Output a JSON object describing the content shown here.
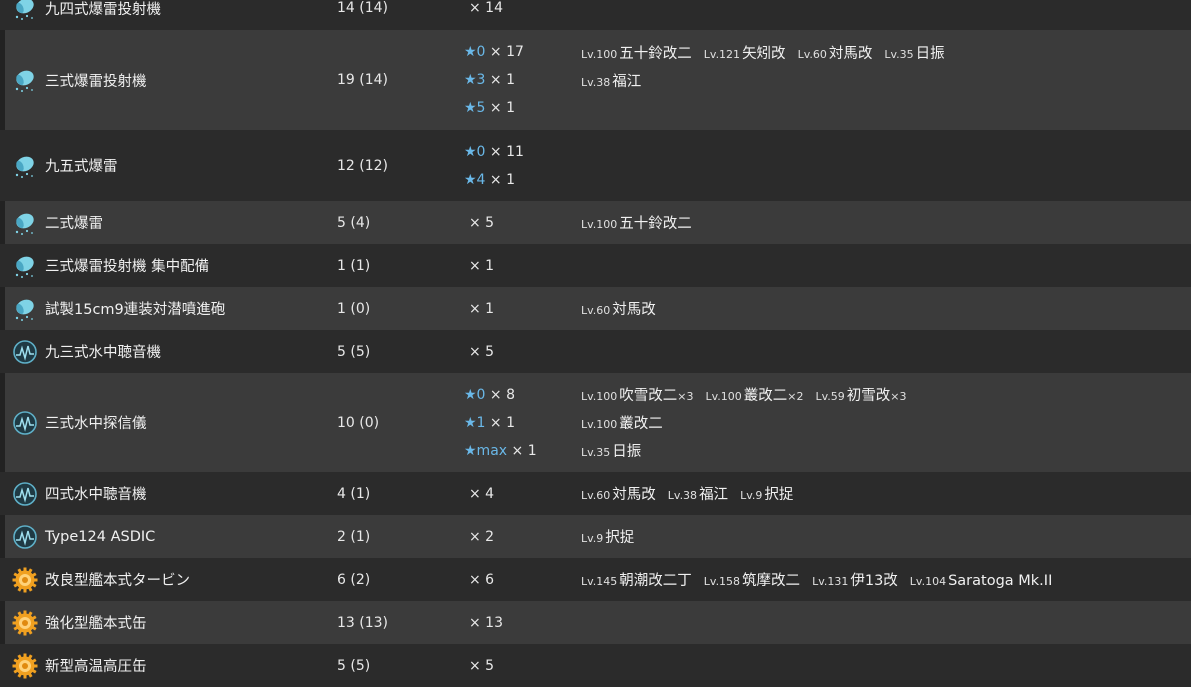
{
  "colors": {
    "row_odd": "#2b2b2b",
    "row_even": "#3b3b3b",
    "star": "#6ab8e8",
    "icon_depth_charge": "#7fd3e6",
    "icon_sonar": "#5fb0c8",
    "icon_turbine": "#f0a020"
  },
  "rows": [
    {
      "icon": "depth-charge-icon",
      "name": "九四式爆雷投射機",
      "count": "14 (14)",
      "levels": [
        {
          "star": "",
          "qty": "× 14",
          "ships": []
        }
      ]
    },
    {
      "icon": "depth-charge-icon",
      "name": "三式爆雷投射機",
      "count": "19 (14)",
      "levels": [
        {
          "star": "★0",
          "qty": "× 17",
          "ships": [
            {
              "lv": "Lv.100",
              "name": "五十鈴改二",
              "mult": ""
            },
            {
              "lv": "Lv.121",
              "name": "矢矧改",
              "mult": ""
            },
            {
              "lv": "Lv.60",
              "name": "対馬改",
              "mult": ""
            },
            {
              "lv": "Lv.35",
              "name": "日振",
              "mult": ""
            }
          ]
        },
        {
          "star": "★3",
          "qty": "× 1",
          "ships": [
            {
              "lv": "Lv.38",
              "name": "福江",
              "mult": ""
            }
          ]
        },
        {
          "star": "★5",
          "qty": "× 1",
          "ships": []
        }
      ]
    },
    {
      "icon": "depth-charge-icon",
      "name": "九五式爆雷",
      "count": "12 (12)",
      "levels": [
        {
          "star": "★0",
          "qty": "× 11",
          "ships": []
        },
        {
          "star": "★4",
          "qty": "× 1",
          "ships": []
        }
      ]
    },
    {
      "icon": "depth-charge-icon",
      "name": "二式爆雷",
      "count": "5 (4)",
      "levels": [
        {
          "star": "",
          "qty": "× 5",
          "ships": [
            {
              "lv": "Lv.100",
              "name": "五十鈴改二",
              "mult": ""
            }
          ]
        }
      ]
    },
    {
      "icon": "depth-charge-icon",
      "name": "三式爆雷投射機 集中配備",
      "count": "1 (1)",
      "levels": [
        {
          "star": "",
          "qty": "× 1",
          "ships": []
        }
      ]
    },
    {
      "icon": "depth-charge-icon",
      "name": "試製15cm9連装対潜噴進砲",
      "count": "1 (0)",
      "levels": [
        {
          "star": "",
          "qty": "× 1",
          "ships": [
            {
              "lv": "Lv.60",
              "name": "対馬改",
              "mult": ""
            }
          ]
        }
      ]
    },
    {
      "icon": "sonar-icon",
      "name": "九三式水中聴音機",
      "count": "5 (5)",
      "levels": [
        {
          "star": "",
          "qty": "× 5",
          "ships": []
        }
      ]
    },
    {
      "icon": "sonar-icon",
      "name": "三式水中探信儀",
      "count": "10 (0)",
      "levels": [
        {
          "star": "★0",
          "qty": "× 8",
          "ships": [
            {
              "lv": "Lv.100",
              "name": "吹雪改二",
              "mult": "×3"
            },
            {
              "lv": "Lv.100",
              "name": "叢改二",
              "mult": "×2"
            },
            {
              "lv": "Lv.59",
              "name": "初雪改",
              "mult": "×3"
            }
          ]
        },
        {
          "star": "★1",
          "qty": "× 1",
          "ships": [
            {
              "lv": "Lv.100",
              "name": "叢改二",
              "mult": ""
            }
          ]
        },
        {
          "star": "★max",
          "qty": "× 1",
          "ships": [
            {
              "lv": "Lv.35",
              "name": "日振",
              "mult": ""
            }
          ]
        }
      ]
    },
    {
      "icon": "sonar-icon",
      "name": "四式水中聴音機",
      "count": "4 (1)",
      "levels": [
        {
          "star": "",
          "qty": "× 4",
          "ships": [
            {
              "lv": "Lv.60",
              "name": "対馬改",
              "mult": ""
            },
            {
              "lv": "Lv.38",
              "name": "福江",
              "mult": ""
            },
            {
              "lv": "Lv.9",
              "name": "択捉",
              "mult": ""
            }
          ]
        }
      ]
    },
    {
      "icon": "sonar-icon",
      "name": "Type124 ASDIC",
      "count": "2 (1)",
      "levels": [
        {
          "star": "",
          "qty": "× 2",
          "ships": [
            {
              "lv": "Lv.9",
              "name": "択捉",
              "mult": ""
            }
          ]
        }
      ]
    },
    {
      "icon": "turbine-icon",
      "name": "改良型艦本式タービン",
      "count": "6 (2)",
      "levels": [
        {
          "star": "",
          "qty": "× 6",
          "ships": [
            {
              "lv": "Lv.145",
              "name": "朝潮改二丁",
              "mult": ""
            },
            {
              "lv": "Lv.158",
              "name": "筑摩改二",
              "mult": ""
            },
            {
              "lv": "Lv.131",
              "name": "伊13改",
              "mult": ""
            },
            {
              "lv": "Lv.104",
              "name": "Saratoga Mk.II",
              "mult": ""
            }
          ]
        }
      ]
    },
    {
      "icon": "turbine-icon",
      "name": "強化型艦本式缶",
      "count": "13 (13)",
      "levels": [
        {
          "star": "",
          "qty": "× 13",
          "ships": []
        }
      ]
    },
    {
      "icon": "turbine-icon",
      "name": "新型高温高圧缶",
      "count": "5 (5)",
      "levels": [
        {
          "star": "",
          "qty": "× 5",
          "ships": []
        }
      ]
    }
  ]
}
